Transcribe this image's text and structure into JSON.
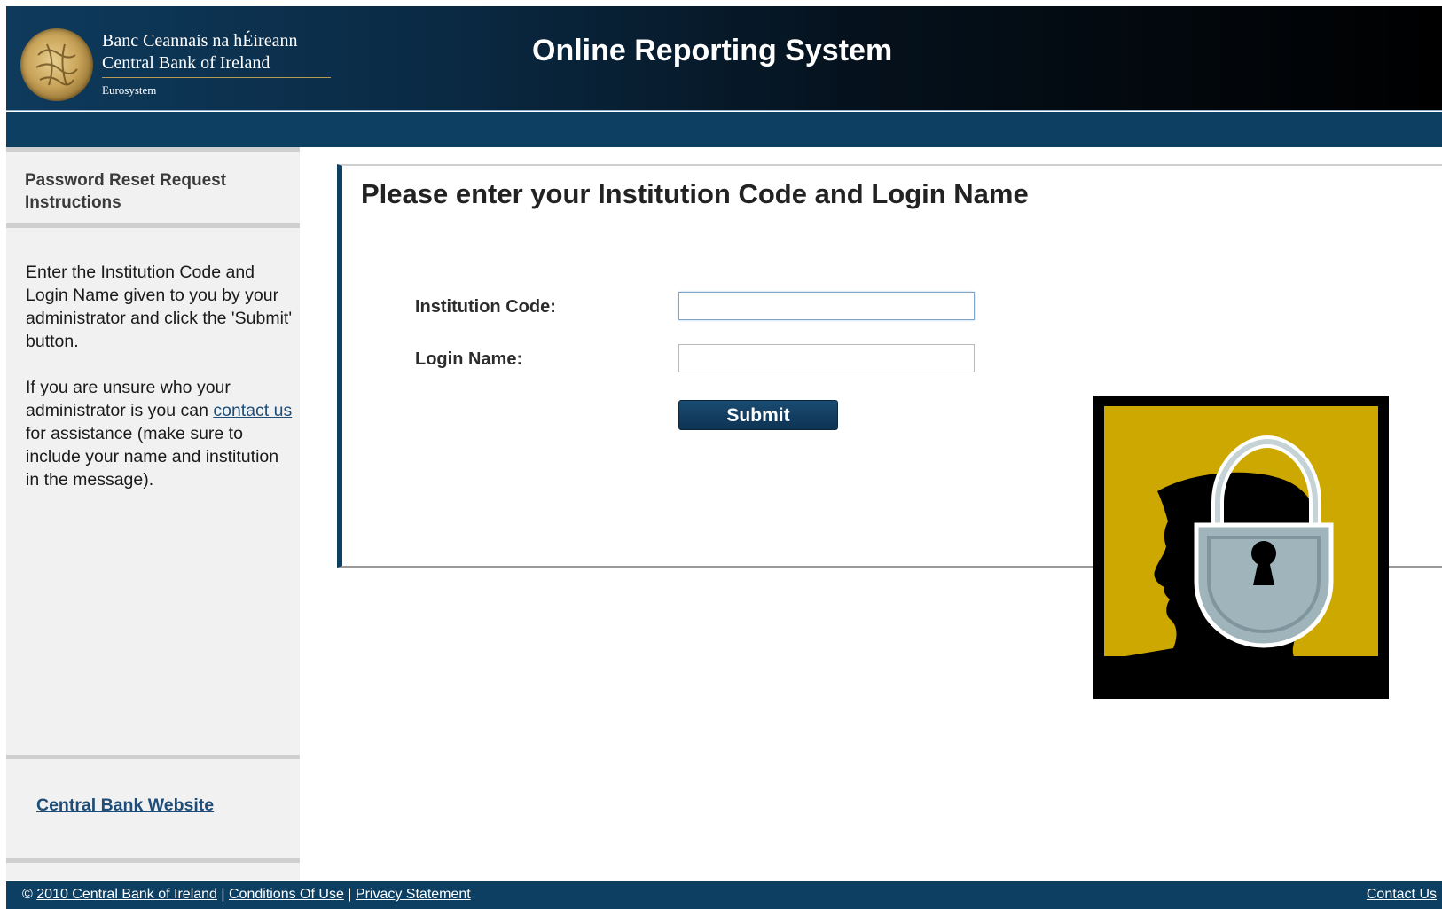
{
  "header": {
    "logo_line1": "Banc Ceannais na hÉireann",
    "logo_line2": "Central Bank of Ireland",
    "logo_line3": "Eurosystem",
    "app_title": "Online Reporting System"
  },
  "sidebar": {
    "title": "Password Reset Request Instructions",
    "paragraph1": "Enter the Institution Code and Login Name given to you by your administrator and click the 'Submit' button.",
    "paragraph2_before": "If you are unsure who your administrator is you can",
    "paragraph2_link": "contact us",
    "paragraph2_after": "for assistance (make sure to include your name and institution in the message).",
    "website_link": "Central Bank Website"
  },
  "form": {
    "heading": "Please enter your Institution Code and Login Name",
    "institution_code_label": "Institution Code:",
    "institution_code_value": "",
    "login_name_label": "Login Name:",
    "login_name_value": "",
    "submit_label": "Submit"
  },
  "footer": {
    "copyright_symbol": "©",
    "copyright_link": "2010 Central Bank of Ireland",
    "separator": "|",
    "conditions_link": "Conditions Of Use",
    "privacy_link": "Privacy Statement",
    "contact_link": "Contact Us"
  },
  "icons": {
    "logo": "central-bank-coin-logo",
    "illustration": "head-padlock-security-icon"
  },
  "colors": {
    "brand_navy": "#0d3f63",
    "illustration_gold": "#cda800",
    "illustration_black": "#000000",
    "lock_grey": "#9fb4bb"
  }
}
